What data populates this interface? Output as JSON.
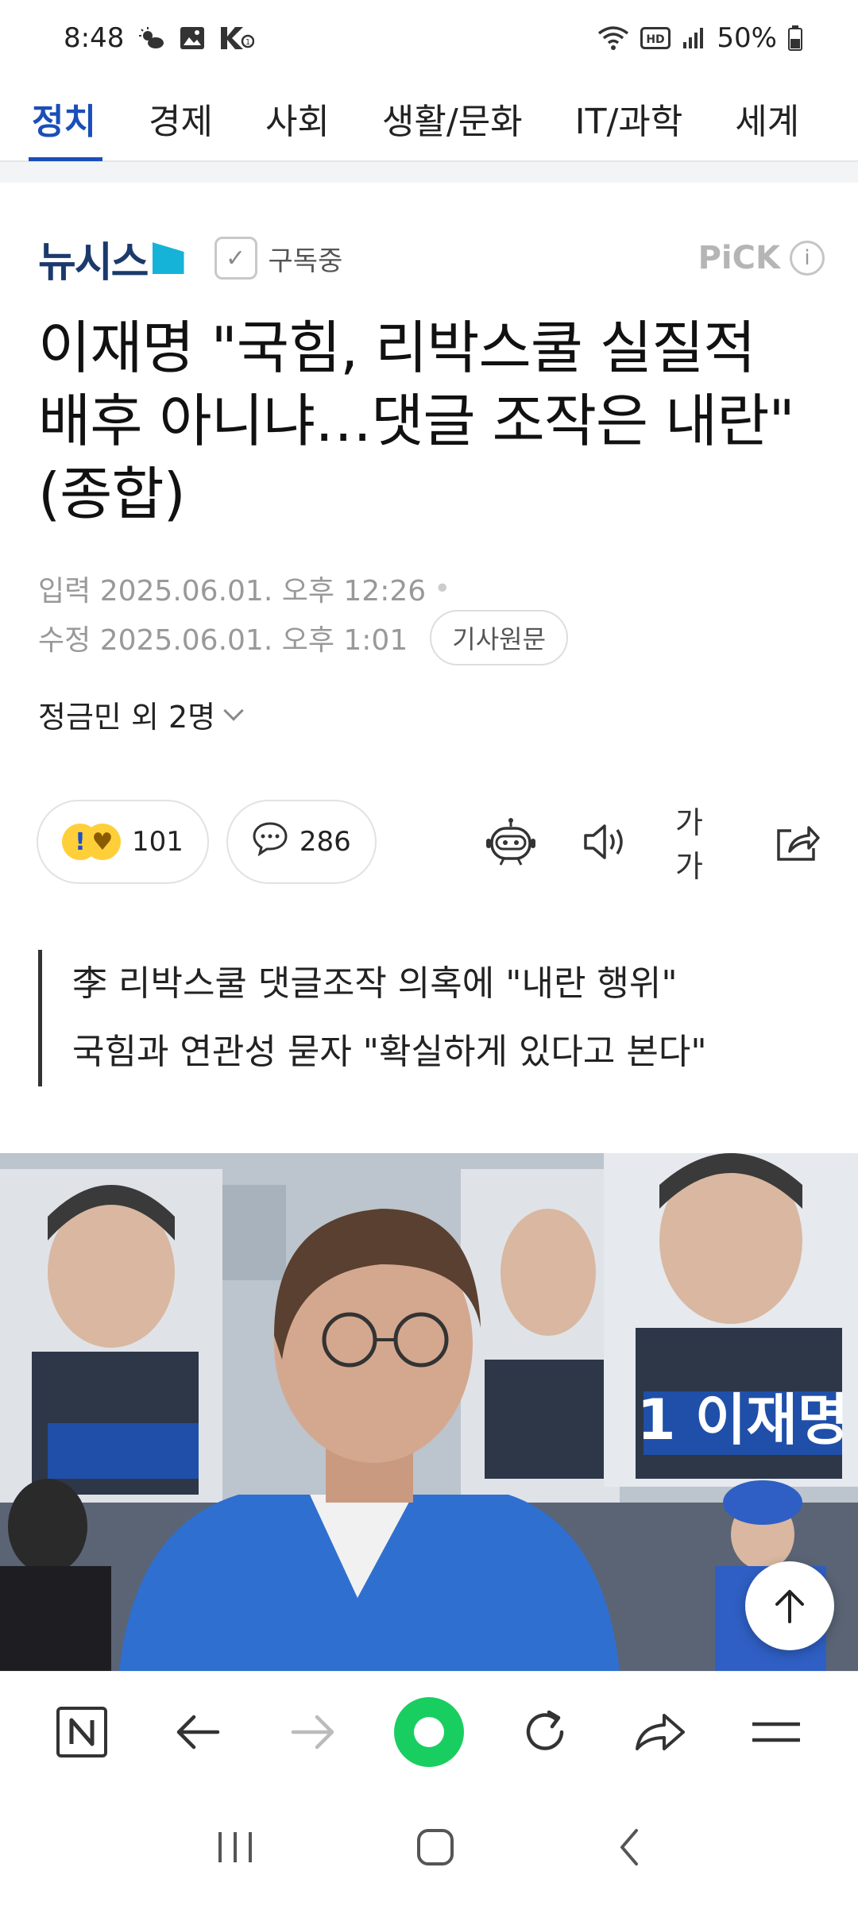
{
  "status_bar": {
    "time": "8:48",
    "battery": "50%"
  },
  "tabs": [
    {
      "label": "정치",
      "active": true
    },
    {
      "label": "경제",
      "active": false
    },
    {
      "label": "사회",
      "active": false
    },
    {
      "label": "생활/문화",
      "active": false
    },
    {
      "label": "IT/과학",
      "active": false
    },
    {
      "label": "세계",
      "active": false
    }
  ],
  "press": {
    "name": "뉴시스",
    "subscribe_label": "구독중",
    "pick_label": "PiCK",
    "info_symbol": "i"
  },
  "article": {
    "headline": "이재명 \"국힘, 리박스쿨 실질적 배후 아니냐…댓글 조작은 내란\"(종합)",
    "input_label": "입력",
    "input_time": "2025.06.01. 오후 12:26",
    "edit_label": "수정",
    "edit_time": "2025.06.01. 오후 1:01",
    "original_button": "기사원문",
    "reporter": "정금민 외 2명",
    "summary_line1": "李 리박스쿨 댓글조작 의혹에 \"내란 행위\"",
    "summary_line2": "국힘과 연관성 묻자 \"확실하게 있다고 본다\""
  },
  "actions": {
    "reaction_count": "101",
    "comment_count": "286",
    "font_size_label": "가가"
  },
  "photo": {
    "sign_text": "1 이재명"
  },
  "colors": {
    "accent": "#1a4fb8",
    "naver_green": "#19ce60",
    "press_blue": "#16b3d8"
  }
}
